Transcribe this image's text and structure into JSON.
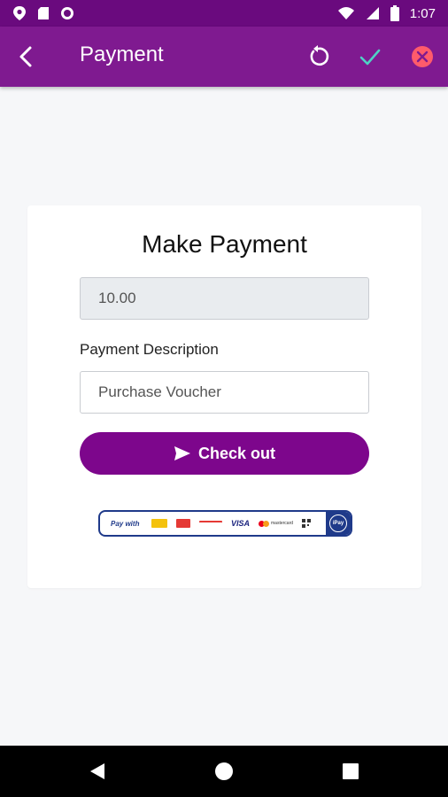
{
  "status_bar": {
    "time": "1:07",
    "icons": [
      "location-icon",
      "sim-icon",
      "circle-icon",
      "wifi-icon",
      "signal-icon",
      "battery-icon"
    ]
  },
  "app_bar": {
    "title": "Payment",
    "color": "#7f1a90",
    "actions": [
      "back-icon",
      "refresh-icon",
      "check-icon",
      "close-circle-icon"
    ]
  },
  "card": {
    "heading": "Make Payment",
    "amount_value": "10.00",
    "description_label": "Payment Description",
    "description_value": "Purchase Voucher",
    "checkout_label": "Check out",
    "checkout_color": "#7d068c",
    "pay_with": {
      "label": "Pay with",
      "visa": "VISA",
      "mastercard": "mastercard",
      "badge": "iPay"
    }
  },
  "nav_bar": {
    "buttons": [
      "back-triangle-icon",
      "home-circle-icon",
      "recents-square-icon"
    ]
  }
}
